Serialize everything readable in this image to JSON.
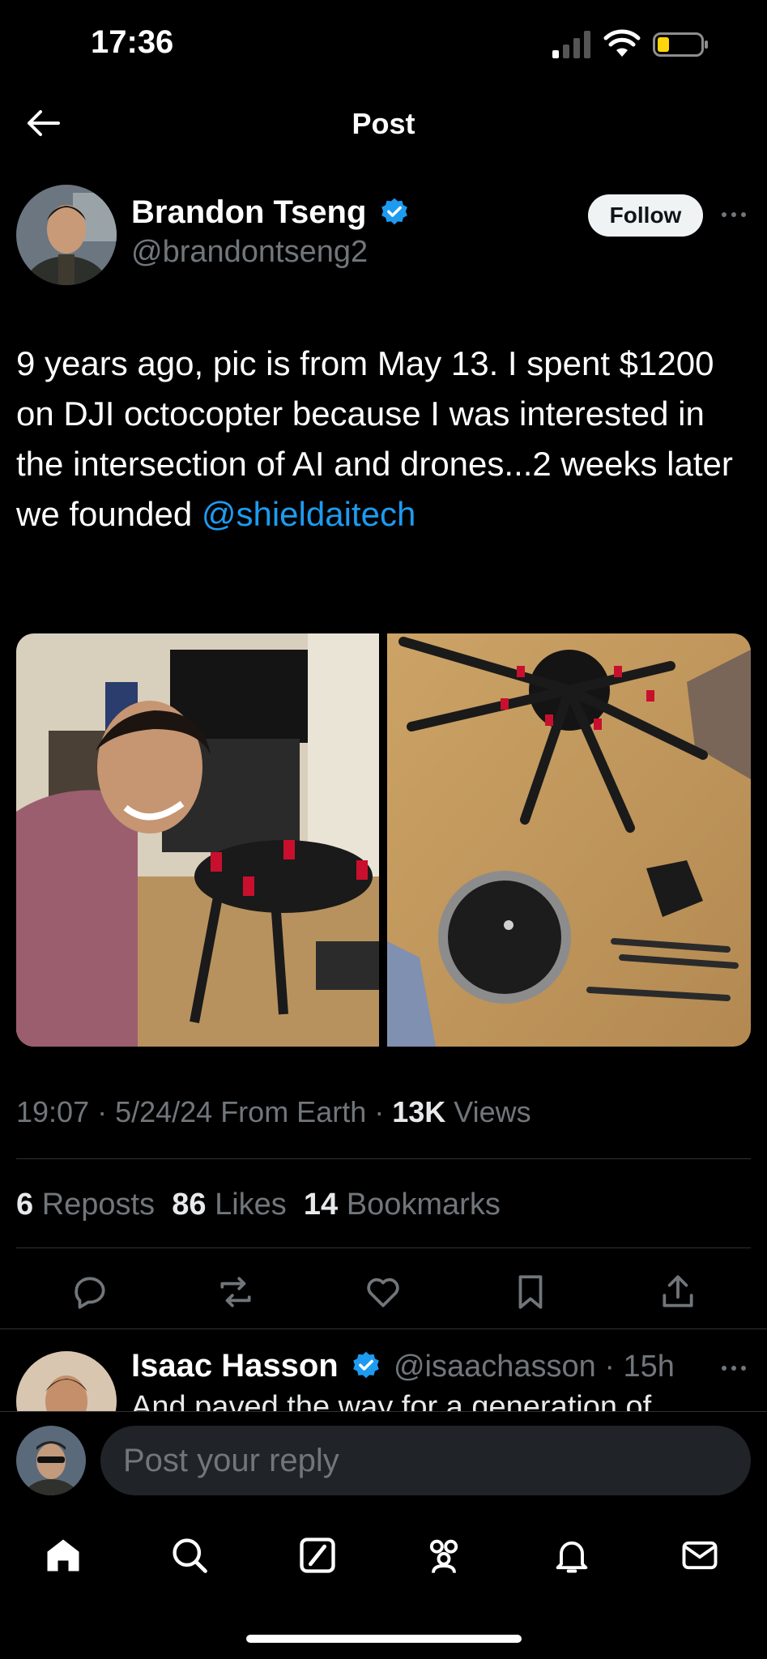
{
  "status_bar": {
    "time": "17:36"
  },
  "header": {
    "title": "Post"
  },
  "post": {
    "author_name": "Brandon Tseng",
    "author_handle": "@brandontseng2",
    "follow_label": "Follow",
    "text_main": "9 years ago, pic is from May 13. I spent $1200 on DJI octocopter because I was interested in the intersection of AI and drones...2 weeks later we founded ",
    "mention": "@shieldaitech",
    "meta_time": "19:07 · 5/24/24 From Earth · ",
    "meta_views_count": "13K",
    "meta_views_label": " Views",
    "stats": {
      "reposts_count": "6",
      "reposts_label": "Reposts",
      "likes_count": "86",
      "likes_label": "Likes",
      "bookmarks_count": "14",
      "bookmarks_label": "Bookmarks"
    }
  },
  "reply": {
    "author_name": "Isaac Hasson",
    "handle_time": "@isaachasson · 15h",
    "text_preview": "And paved the way for a generation of"
  },
  "composer": {
    "placeholder": "Post your reply"
  },
  "colors": {
    "accent": "#1d9bf0",
    "background": "#000000",
    "muted": "#71767b"
  },
  "icons": {
    "actions": [
      "reply-icon",
      "repost-icon",
      "like-icon",
      "bookmark-icon",
      "share-icon"
    ],
    "tabs": [
      "home-icon",
      "search-icon",
      "grok-icon",
      "communities-icon",
      "notifications-icon",
      "messages-icon"
    ]
  }
}
